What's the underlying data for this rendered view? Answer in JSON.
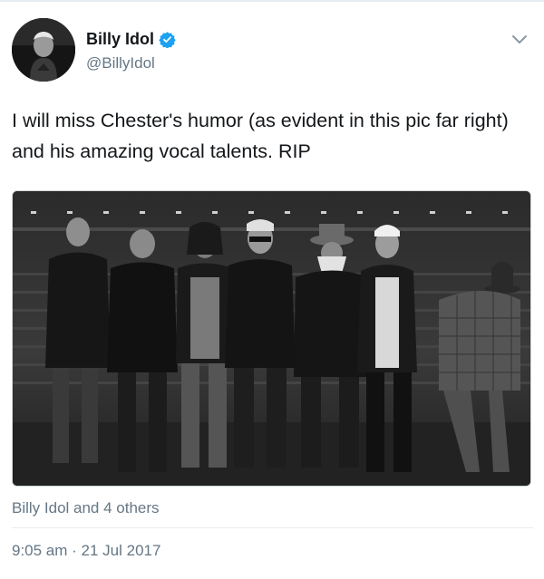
{
  "author": {
    "display_name": "Billy Idol",
    "handle": "@BillyIdol",
    "verified": true,
    "avatar_icon": "profile-photo"
  },
  "tweet": {
    "text": "I will miss Chester's humor (as evident in this pic far right) and his amazing vocal talents. RIP",
    "media_icon": "photo-grayscale"
  },
  "engagement": {
    "liked_by": "Billy Idol and 4 others"
  },
  "meta": {
    "timestamp": "9:05 am · 21 Jul 2017"
  },
  "icons": {
    "menu": "chevron-down-icon",
    "verified": "verified-badge-icon"
  },
  "colors": {
    "text_primary": "#14171a",
    "text_secondary": "#657786",
    "verified_blue": "#1da1f2",
    "divider": "#e6ecf0"
  }
}
